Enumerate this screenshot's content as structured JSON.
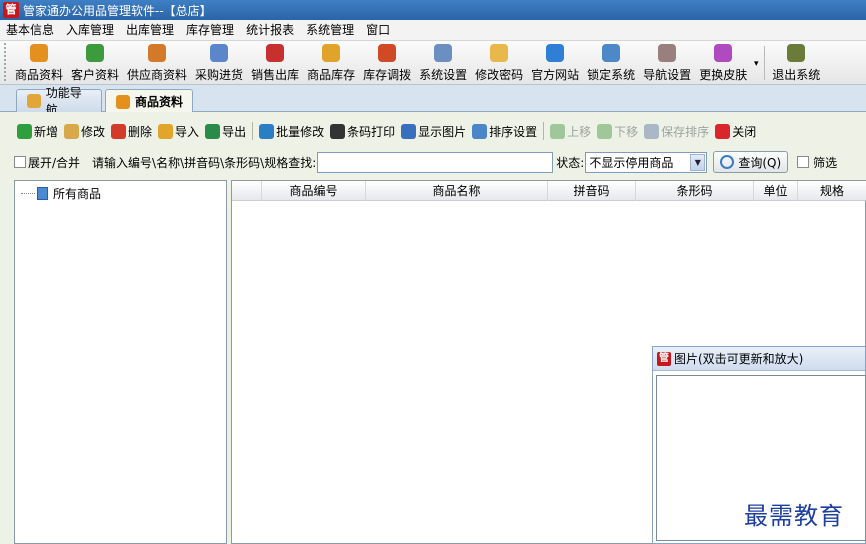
{
  "window": {
    "title": "管家通办公用品管理软件--【总店】"
  },
  "menu": [
    "基本信息",
    "入库管理",
    "出库管理",
    "库存管理",
    "统计报表",
    "系统管理",
    "窗口"
  ],
  "toolbar": {
    "items": [
      {
        "label": "商品资料",
        "icon": "goods-icon",
        "color": "#e3901e"
      },
      {
        "label": "客户资料",
        "icon": "customers-icon",
        "color": "#3d9a3d"
      },
      {
        "label": "供应商资料",
        "icon": "supplier-icon",
        "color": "#d4782a"
      },
      {
        "label": "采购进货",
        "icon": "purchase-icon",
        "color": "#5b86c9"
      },
      {
        "label": "销售出库",
        "icon": "sales-icon",
        "color": "#c83030"
      },
      {
        "label": "商品库存",
        "icon": "stock-icon",
        "color": "#e0a42a"
      },
      {
        "label": "库存调拨",
        "icon": "transfer-icon",
        "color": "#d04a26"
      },
      {
        "label": "系统设置",
        "icon": "settings-icon",
        "color": "#6a8fc0"
      },
      {
        "label": "修改密码",
        "icon": "password-icon",
        "color": "#e8b84a"
      },
      {
        "label": "官方网站",
        "icon": "ie-browser-icon",
        "color": "#2f7fd6"
      },
      {
        "label": "锁定系统",
        "icon": "lock-icon",
        "color": "#4d88c8"
      },
      {
        "label": "导航设置",
        "icon": "navigation-icon",
        "color": "#9a7f7f"
      },
      {
        "label": "更换皮肤",
        "icon": "skin-icon",
        "color": "#b04ac0"
      }
    ],
    "exit_label": "退出系统"
  },
  "tabs": [
    {
      "label": "功能导航",
      "icon": "home-icon",
      "active": false
    },
    {
      "label": "商品资料",
      "icon": "goods-icon",
      "active": true
    }
  ],
  "actions": [
    {
      "label": "新增",
      "icon": "add-icon",
      "color": "#2e9e3e",
      "enabled": true
    },
    {
      "label": "修改",
      "icon": "edit-icon",
      "color": "#d7a94b",
      "enabled": true
    },
    {
      "label": "删除",
      "icon": "delete-icon",
      "color": "#d23a2a",
      "enabled": true
    },
    {
      "label": "导入",
      "icon": "import-icon",
      "color": "#e0a52a",
      "enabled": true
    },
    {
      "label": "导出",
      "icon": "export-icon",
      "color": "#2a8a4a",
      "enabled": true
    },
    {
      "label": "批量修改",
      "icon": "batch-edit-icon",
      "color": "#2a7fc4",
      "enabled": true
    },
    {
      "label": "条码打印",
      "icon": "barcode-icon",
      "color": "#333333",
      "enabled": true
    },
    {
      "label": "显示图片",
      "icon": "image-icon",
      "color": "#3a6fc0",
      "enabled": true
    },
    {
      "label": "排序设置",
      "icon": "sort-icon",
      "color": "#4a86c8",
      "enabled": true
    },
    {
      "label": "上移",
      "icon": "move-up-icon",
      "color": "#9fc79a",
      "enabled": false
    },
    {
      "label": "下移",
      "icon": "move-down-icon",
      "color": "#9fc79a",
      "enabled": false
    },
    {
      "label": "保存排序",
      "icon": "save-icon",
      "color": "#a9b7c7",
      "enabled": false
    },
    {
      "label": "关闭",
      "icon": "close-icon",
      "color": "#d8262c",
      "enabled": true
    }
  ],
  "search": {
    "expand_label": "展开/合并",
    "prompt": "请输入编号\\名称\\拼音码\\条形码\\规格查找:",
    "value": "",
    "status_label": "状态:",
    "status_value": "不显示停用商品",
    "query_label": "查询(Q)",
    "filter_label": "筛选"
  },
  "tree": {
    "root_label": "所有商品"
  },
  "grid": {
    "columns": [
      "商品编号",
      "商品名称",
      "拼音码",
      "条形码",
      "单位",
      "规格"
    ],
    "rows": []
  },
  "image_window": {
    "title": "图片(双击可更新和放大)"
  },
  "watermark": "最需教育",
  "colors": {
    "titlebar": "#2f6db4",
    "brand_red": "#c8161d"
  }
}
